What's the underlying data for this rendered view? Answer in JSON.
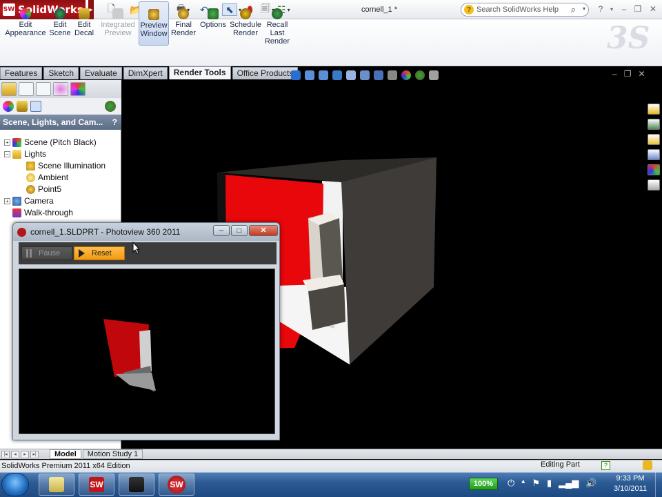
{
  "app": {
    "logo_text": "SolidWorks",
    "logo_badge": "SW",
    "document_title": "cornell_1 *"
  },
  "search": {
    "placeholder": "Search SolidWorks Help"
  },
  "ribbon": {
    "buttons": [
      {
        "label": "Edit\nAppearance"
      },
      {
        "label": "Edit\nScene"
      },
      {
        "label": "Edit\nDecal"
      },
      {
        "label": "Integrated\nPreview"
      },
      {
        "label": "Preview\nWindow"
      },
      {
        "label": "Final\nRender"
      },
      {
        "label": "Options"
      },
      {
        "label": "Schedule\nRender"
      },
      {
        "label": "Recall\nLast\nRender"
      }
    ]
  },
  "tabs": [
    {
      "label": "Features"
    },
    {
      "label": "Sketch"
    },
    {
      "label": "Evaluate"
    },
    {
      "label": "DimXpert"
    },
    {
      "label": "Render Tools"
    },
    {
      "label": "Office Products"
    }
  ],
  "panel": {
    "header": "Scene, Lights, and Cam...",
    "help_glyph": "?",
    "tree": [
      {
        "label": "Scene (Pitch Black)"
      },
      {
        "label": "Lights"
      },
      {
        "label": "Scene Illumination"
      },
      {
        "label": "Ambient"
      },
      {
        "label": "Point5"
      },
      {
        "label": "Camera"
      },
      {
        "label": "Walk-through"
      }
    ]
  },
  "photoview": {
    "title": "cornell_1.SLDPRT - Photoview 360 2011",
    "pause_label": "Pause",
    "reset_label": "Reset"
  },
  "bottom_tabs": [
    {
      "label": "Model"
    },
    {
      "label": "Motion Study 1"
    }
  ],
  "status": {
    "edition": "SolidWorks Premium 2011 x64 Edition",
    "mode": "Editing Part",
    "help_glyph": "?"
  },
  "taskbar": {
    "battery": "100%",
    "time": "9:33 PM",
    "date": "3/10/2011"
  },
  "colors": {
    "accent_red": "#c0161b",
    "reset_orange": "#f29a10",
    "scene_red": "#e8080c",
    "viewport_bg": "#000000"
  },
  "icons": {
    "new": "new-document-icon",
    "open": "open-folder-icon",
    "save": "save-icon",
    "print": "print-icon",
    "undo": "undo-icon",
    "select": "select-arrow-icon",
    "rebuild": "traffic-light-icon",
    "file_props": "file-properties-icon",
    "options": "options-icon"
  }
}
